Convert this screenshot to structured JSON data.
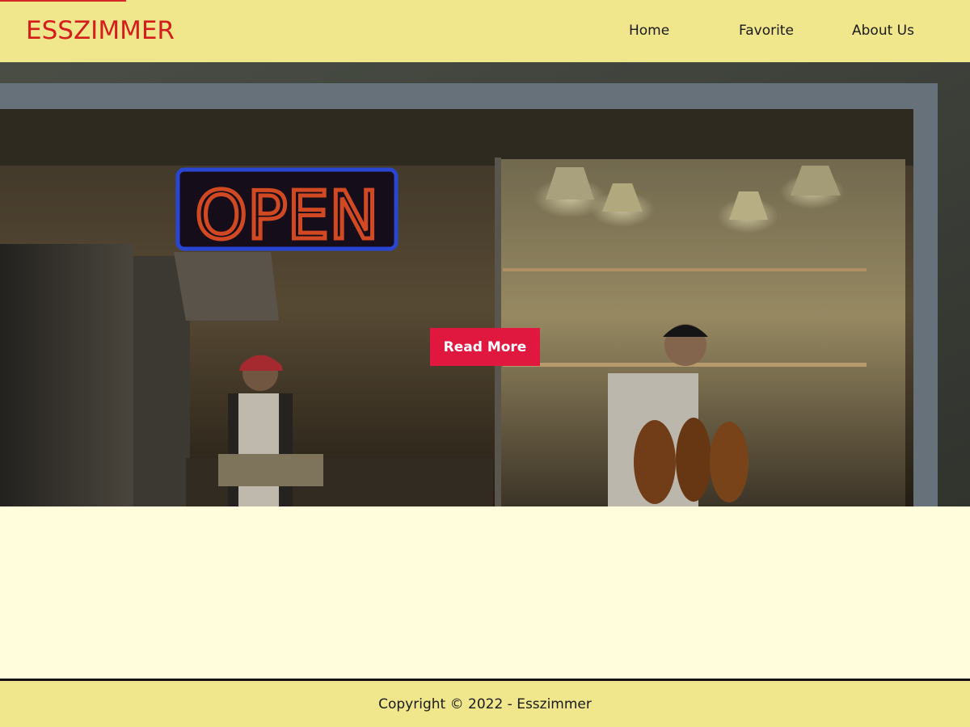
{
  "header": {
    "brand": "ESSZIMMER",
    "nav": [
      {
        "label": "Home"
      },
      {
        "label": "Favorite"
      },
      {
        "label": "About Us"
      }
    ]
  },
  "hero": {
    "neon_sign_text": "OPEN",
    "cta_label": "Read More"
  },
  "footer": {
    "copyright": "Copyright © 2022 - Esszimmer"
  },
  "colors": {
    "header_bg": "#f0e68c",
    "brand": "#d41e1e",
    "cta_bg": "#e0173f",
    "page_bg": "#fffddb"
  }
}
